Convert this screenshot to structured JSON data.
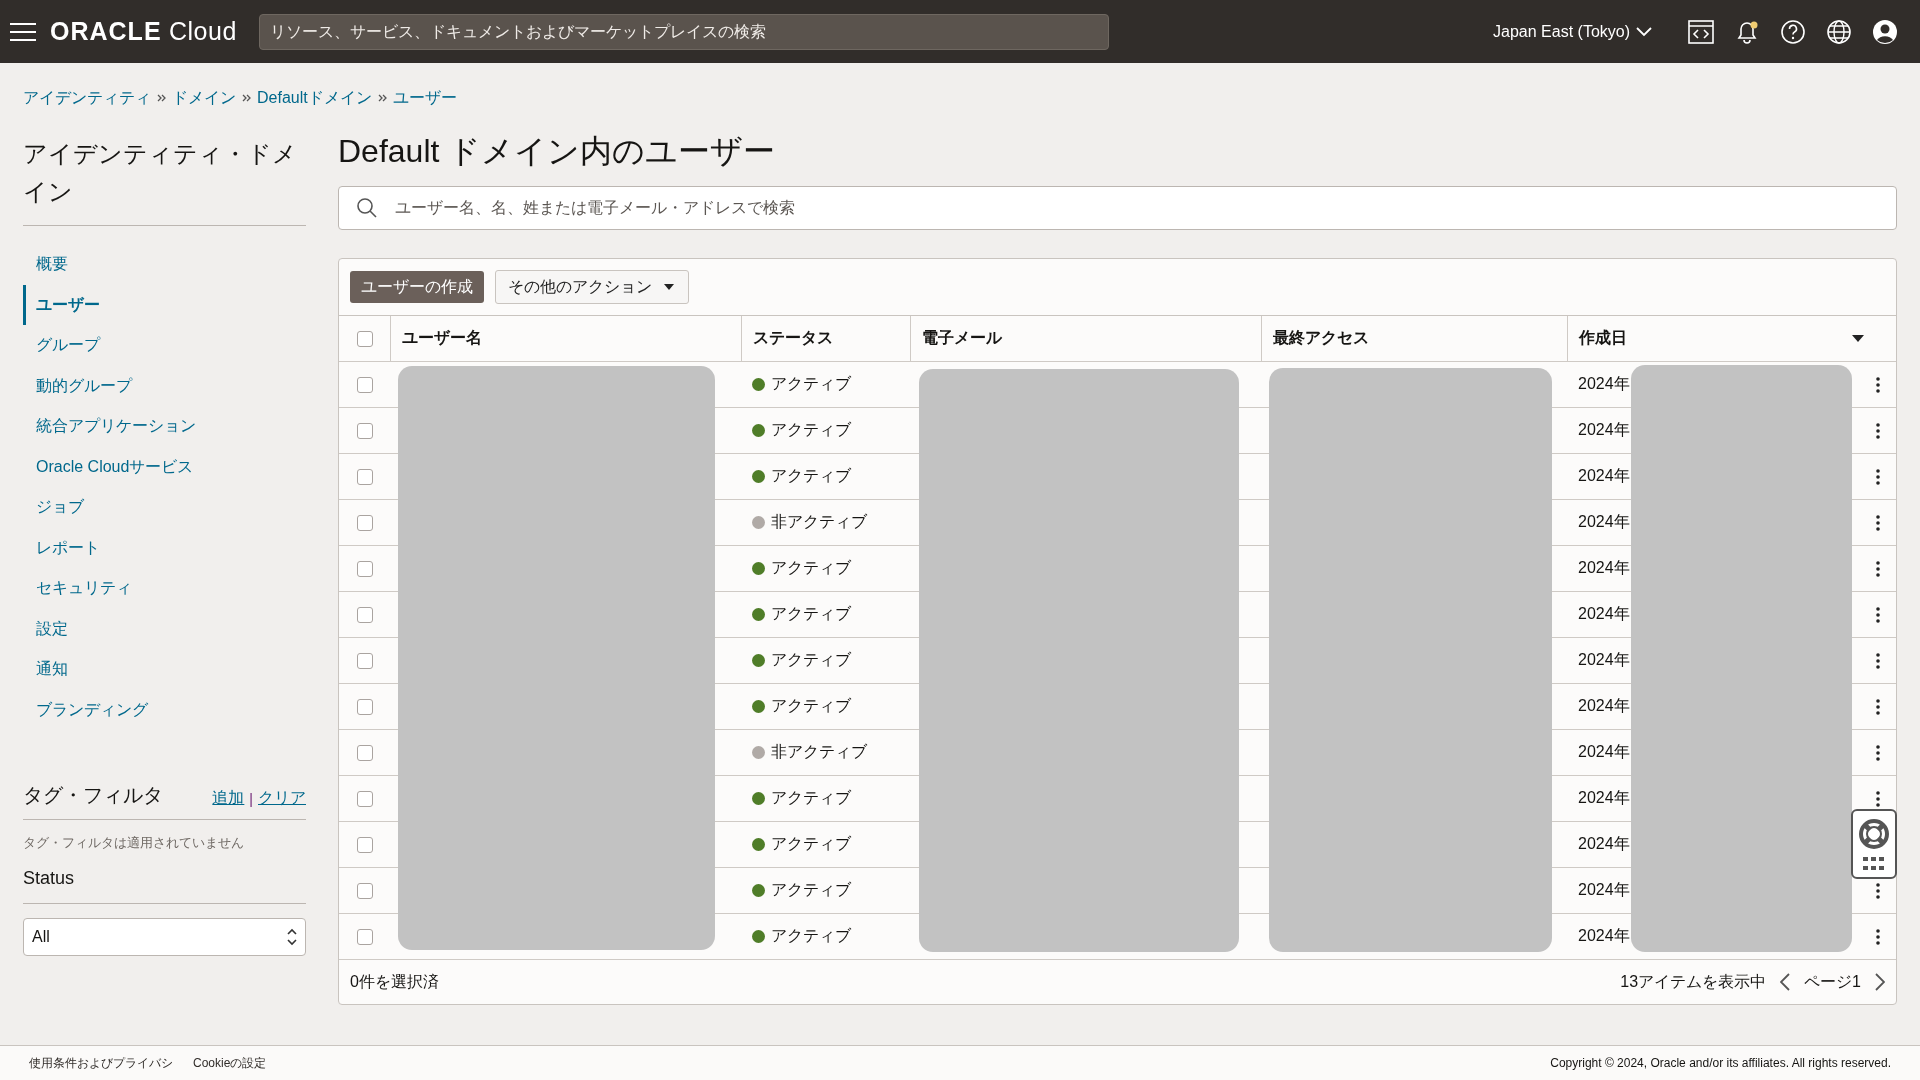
{
  "header": {
    "logo_brand": "ORACLE",
    "logo_product": "Cloud",
    "search_placeholder": "リソース、サービス、ドキュメントおよびマーケットプレイスの検索",
    "region": "Japan East (Tokyo)",
    "notification_unread": true
  },
  "breadcrumb": [
    "アイデンティティ",
    "ドメイン",
    "Defaultドメイン",
    "ユーザー"
  ],
  "sidebar": {
    "title": "アイデンティティ・ドメイン",
    "items": [
      {
        "label": "概要",
        "selected": false
      },
      {
        "label": "ユーザー",
        "selected": true
      },
      {
        "label": "グループ",
        "selected": false
      },
      {
        "label": "動的グループ",
        "selected": false
      },
      {
        "label": "統合アプリケーション",
        "selected": false
      },
      {
        "label": "Oracle Cloudサービス",
        "selected": false
      },
      {
        "label": "ジョブ",
        "selected": false
      },
      {
        "label": "レポート",
        "selected": false
      },
      {
        "label": "セキュリティ",
        "selected": false
      },
      {
        "label": "設定",
        "selected": false
      },
      {
        "label": "通知",
        "selected": false
      },
      {
        "label": "ブランディング",
        "selected": false
      }
    ],
    "tag_filter": {
      "title": "タグ・フィルタ",
      "add": "追加",
      "separator": "|",
      "clear": "クリア",
      "empty": "タグ・フィルタは適用されていません"
    },
    "status_filter": {
      "title": "Status",
      "value": "All"
    }
  },
  "page_title": "Default ドメイン内のユーザー",
  "search": {
    "placeholder": "ユーザー名、名、姓または電子メール・アドレスで検索"
  },
  "toolbar": {
    "create": "ユーザーの作成",
    "more_actions": "その他のアクション"
  },
  "table": {
    "select_all": false,
    "columns": [
      "ユーザー名",
      "ステータス",
      "電子メール",
      "最終アクセス",
      "作成日"
    ],
    "rows": [
      {
        "selected": false,
        "status": "アクティブ",
        "active": true,
        "created": "2024年"
      },
      {
        "selected": false,
        "status": "アクティブ",
        "active": true,
        "created": "2024年"
      },
      {
        "selected": false,
        "status": "アクティブ",
        "active": true,
        "created": "2024年"
      },
      {
        "selected": false,
        "status": "非アクティブ",
        "active": false,
        "created": "2024年"
      },
      {
        "selected": false,
        "status": "アクティブ",
        "active": true,
        "created": "2024年"
      },
      {
        "selected": false,
        "status": "アクティブ",
        "active": true,
        "created": "2024年"
      },
      {
        "selected": false,
        "status": "アクティブ",
        "active": true,
        "created": "2024年"
      },
      {
        "selected": false,
        "status": "アクティブ",
        "active": true,
        "created": "2024年"
      },
      {
        "selected": false,
        "status": "非アクティブ",
        "active": false,
        "created": "2024年"
      },
      {
        "selected": false,
        "status": "アクティブ",
        "active": true,
        "created": "2024年"
      },
      {
        "selected": false,
        "status": "アクティブ",
        "active": true,
        "created": "2024年"
      },
      {
        "selected": false,
        "status": "アクティブ",
        "active": true,
        "created": "2024年"
      },
      {
        "selected": false,
        "status": "アクティブ",
        "active": true,
        "created": "2024年"
      }
    ],
    "selected_count": "0件を選択済",
    "item_count": "13アイテムを表示中",
    "page": "ページ1"
  },
  "footer": {
    "links": [
      "使用条件およびプライバシ",
      "Cookieの設定"
    ],
    "copyright": "Copyright © 2024, Oracle and/or its affiliates. All rights reserved."
  }
}
